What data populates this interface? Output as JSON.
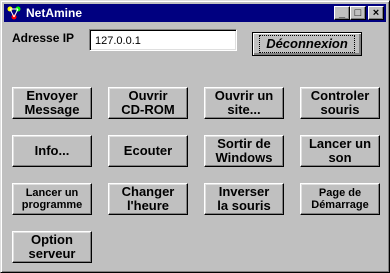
{
  "window": {
    "title": "NetAmine",
    "app_icon": "netamine-app-icon",
    "controls": {
      "minimize": "_",
      "maximize": "□",
      "close": "×"
    }
  },
  "connection": {
    "label": "Adresse IP",
    "ip_value": "127.0.0.1",
    "disconnect_label": "Déconnexion"
  },
  "buttons": [
    {
      "lines": [
        "Envoyer",
        "Message"
      ]
    },
    {
      "lines": [
        "Ouvrir",
        "CD-ROM"
      ]
    },
    {
      "lines": [
        "Ouvrir un",
        "site..."
      ]
    },
    {
      "lines": [
        "Controler",
        "souris"
      ]
    },
    {
      "lines": [
        "Info..."
      ]
    },
    {
      "lines": [
        "Ecouter"
      ]
    },
    {
      "lines": [
        "Sortir de",
        "Windows"
      ]
    },
    {
      "lines": [
        "Lancer un",
        "son"
      ]
    },
    {
      "lines": [
        "Lancer un",
        "programme"
      ]
    },
    {
      "lines": [
        "Changer",
        "l'heure"
      ]
    },
    {
      "lines": [
        "Inverser",
        "la souris"
      ]
    },
    {
      "lines": [
        "Page de",
        "Démarrage"
      ]
    },
    {
      "lines": [
        "Option",
        "serveur"
      ]
    }
  ]
}
